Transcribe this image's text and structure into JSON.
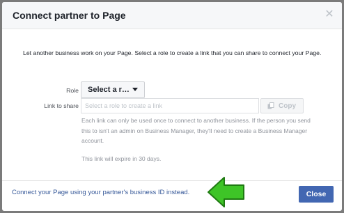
{
  "dialog": {
    "title": "Connect partner to Page",
    "close_icon": "close-icon",
    "intro": "Let another business work on your Page. Select a role to create a link that you can share to connect your Page."
  },
  "form": {
    "role_label": "Role",
    "role_selected": "Select a r…",
    "link_label": "Link to share",
    "link_placeholder": "Select a role to create a link",
    "link_value": "",
    "copy_label": "Copy",
    "copy_icon": "copy-icon",
    "help_text": "Each link can only be used once to connect to another business. If the person you send this to isn't an admin on Business Manager, they'll need to create a Business Manager account.",
    "expire_text": "This link will expire in 30 days."
  },
  "footer": {
    "alt_link": "Connect your Page using your partner's business ID instead.",
    "close_label": "Close",
    "annotation_icon": "arrow-left-icon"
  },
  "colors": {
    "primary": "#4267b2",
    "link": "#365899",
    "annotation_arrow": "#3ec427"
  }
}
